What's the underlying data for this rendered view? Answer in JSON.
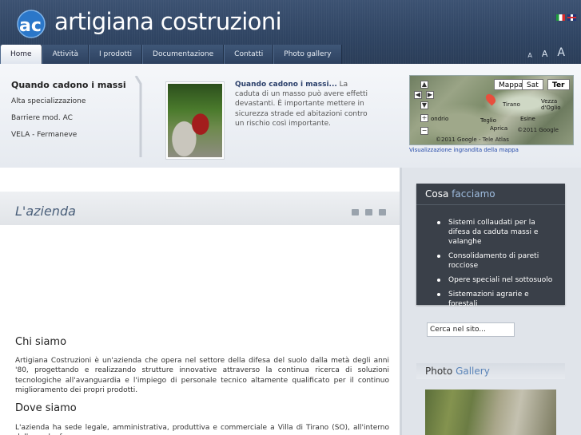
{
  "header": {
    "logo_text": "artigiana costruzioni",
    "languages": [
      "it-flag-icon",
      "uk-flag-icon"
    ]
  },
  "nav": {
    "tabs": [
      {
        "label": "Home",
        "active": true
      },
      {
        "label": "Attività",
        "active": false
      },
      {
        "label": "I prodotti",
        "active": false
      },
      {
        "label": "Documentazione",
        "active": false
      },
      {
        "label": "Contatti",
        "active": false
      },
      {
        "label": "Photo gallery",
        "active": false
      }
    ],
    "font_size": [
      "A",
      "A",
      "A"
    ]
  },
  "sidebar_top": {
    "title": "Quando cadono i massi",
    "items": [
      "Alta specializzazione",
      "Barriere mod. AC",
      "VELA - Fermaneve"
    ]
  },
  "teaser": {
    "headline": "Quando cadono i massi...",
    "body": " La caduta di un masso può avere effetti devastanti. È importante mettere in sicurezza strade ed abitazioni contro un rischio così importante."
  },
  "map": {
    "types": [
      "Mappa",
      "Sat",
      "Ter"
    ],
    "selected_type": "Ter",
    "labels": [
      "Tirano",
      "Teglio",
      "Aprica",
      "Esine",
      "Vezza d'Oglio",
      "ondrio"
    ],
    "credit": "©2011 Google - Tele Atlas",
    "google": "©2011 Google",
    "link": "Visualizzazione ingrandita della mappa"
  },
  "main": {
    "page_title": "L'azienda",
    "sections": [
      {
        "heading": "Chi siamo",
        "body": "Artigiana Costruzioni è un'azienda che opera nel settore della difesa del suolo dalla metà degli anni '80, progettando e realizzando strutture innovative attraverso la continua ricerca di soluzioni tecnologiche all'avanguardia e l'impiego di personale tecnico altamente qualificato per il continuo miglioramento dei propri prodotti."
      },
      {
        "heading": "Dove siamo",
        "body": "L'azienda ha sede legale, amministrativa, produttiva e commerciale a Villa di Tirano (SO), all'interno della quale, fra"
      }
    ]
  },
  "right": {
    "box_title_1": "Cosa",
    "box_title_2": "facciamo",
    "bullets": [
      "Sistemi collaudati per la difesa da caduta massi e valanghe",
      "Consolidamento di pareti rocciose",
      "Opere speciali nel sottosuolo",
      "Sistemazioni agrarie e forestali"
    ],
    "search_value": "Cerca nel sito...",
    "gallery_1": "Photo",
    "gallery_2": "Gallery"
  }
}
